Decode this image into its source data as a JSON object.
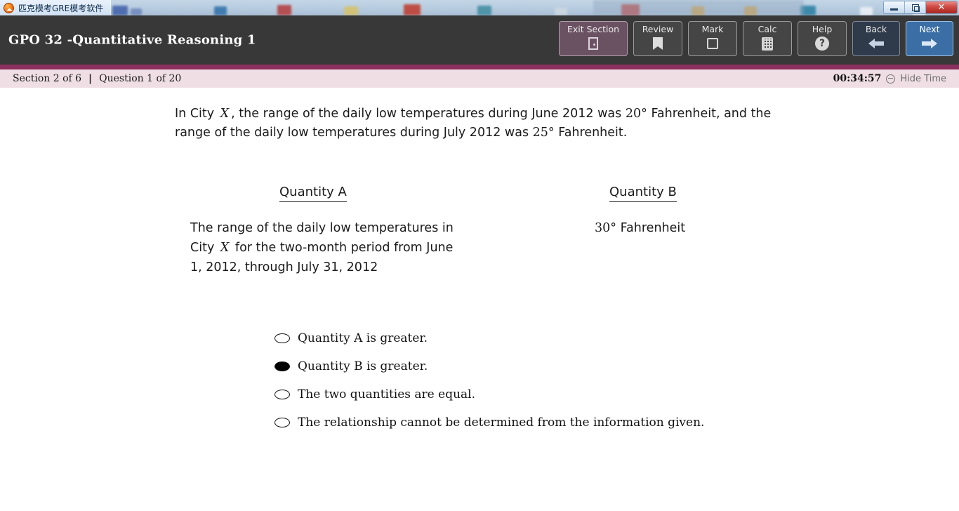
{
  "window": {
    "app_title": "匹克模考GRE模考软件",
    "app_icon": "app-logo-icon",
    "controls": {
      "minimize": "minimize-icon",
      "maximize": "restore-icon",
      "close": "✕"
    }
  },
  "header": {
    "title": "GPO 32 -Quantitative Reasoning 1",
    "buttons": [
      {
        "label": "Exit Section",
        "icon": "door-icon",
        "name": "exit-section"
      },
      {
        "label": "Review",
        "icon": "bookmark-icon",
        "name": "review"
      },
      {
        "label": "Mark",
        "icon": "square-checkbox-icon",
        "name": "mark"
      },
      {
        "label": "Calc",
        "icon": "calculator-icon",
        "name": "calc"
      },
      {
        "label": "Help",
        "icon": "question-mark-icon",
        "name": "help"
      },
      {
        "label": "Back",
        "icon": "arrow-left-icon",
        "name": "back"
      },
      {
        "label": "Next",
        "icon": "arrow-right-icon",
        "name": "next"
      }
    ]
  },
  "status": {
    "section": "Section 2 of 6",
    "separator": "|",
    "question": "Question 1 of 20",
    "timer": "00:34:57",
    "hide_time_label": "Hide Time",
    "hide_time_icon": "circle-minus-icon"
  },
  "question": {
    "stem_part1": "In City ",
    "stem_var1": "X",
    "stem_part2": ", the range of the daily low temperatures during June 2012 was ",
    "stem_deg1": "20°",
    "stem_part3": " Fahrenheit, and the range of the daily low temperatures during July 2012 was ",
    "stem_deg2": "25°",
    "stem_part4": " Fahrenheit.",
    "quantity_a_header": "Quantity A",
    "quantity_b_header": "Quantity B",
    "quantity_a_part1": "The range of the daily low temperatures in City ",
    "quantity_a_var": "X",
    "quantity_a_part2": " for the two-month period from June 1, 2012, through July 31, 2012",
    "quantity_b_deg": "30°",
    "quantity_b_text": " Fahrenheit",
    "options": [
      {
        "label": "Quantity A is greater.",
        "selected": false
      },
      {
        "label": "Quantity B is greater.",
        "selected": true
      },
      {
        "label": "The two quantities are equal.",
        "selected": false
      },
      {
        "label": "The relationship cannot be determined from the information given.",
        "selected": false
      }
    ]
  },
  "colors": {
    "header_bg": "#383838",
    "divider": "#8b2f5c",
    "statusbar_bg": "#efdfe4",
    "exit_section_bg": "#6b5263",
    "next_bg": "#3a6ea5",
    "back_bg": "#2f3a4a"
  }
}
